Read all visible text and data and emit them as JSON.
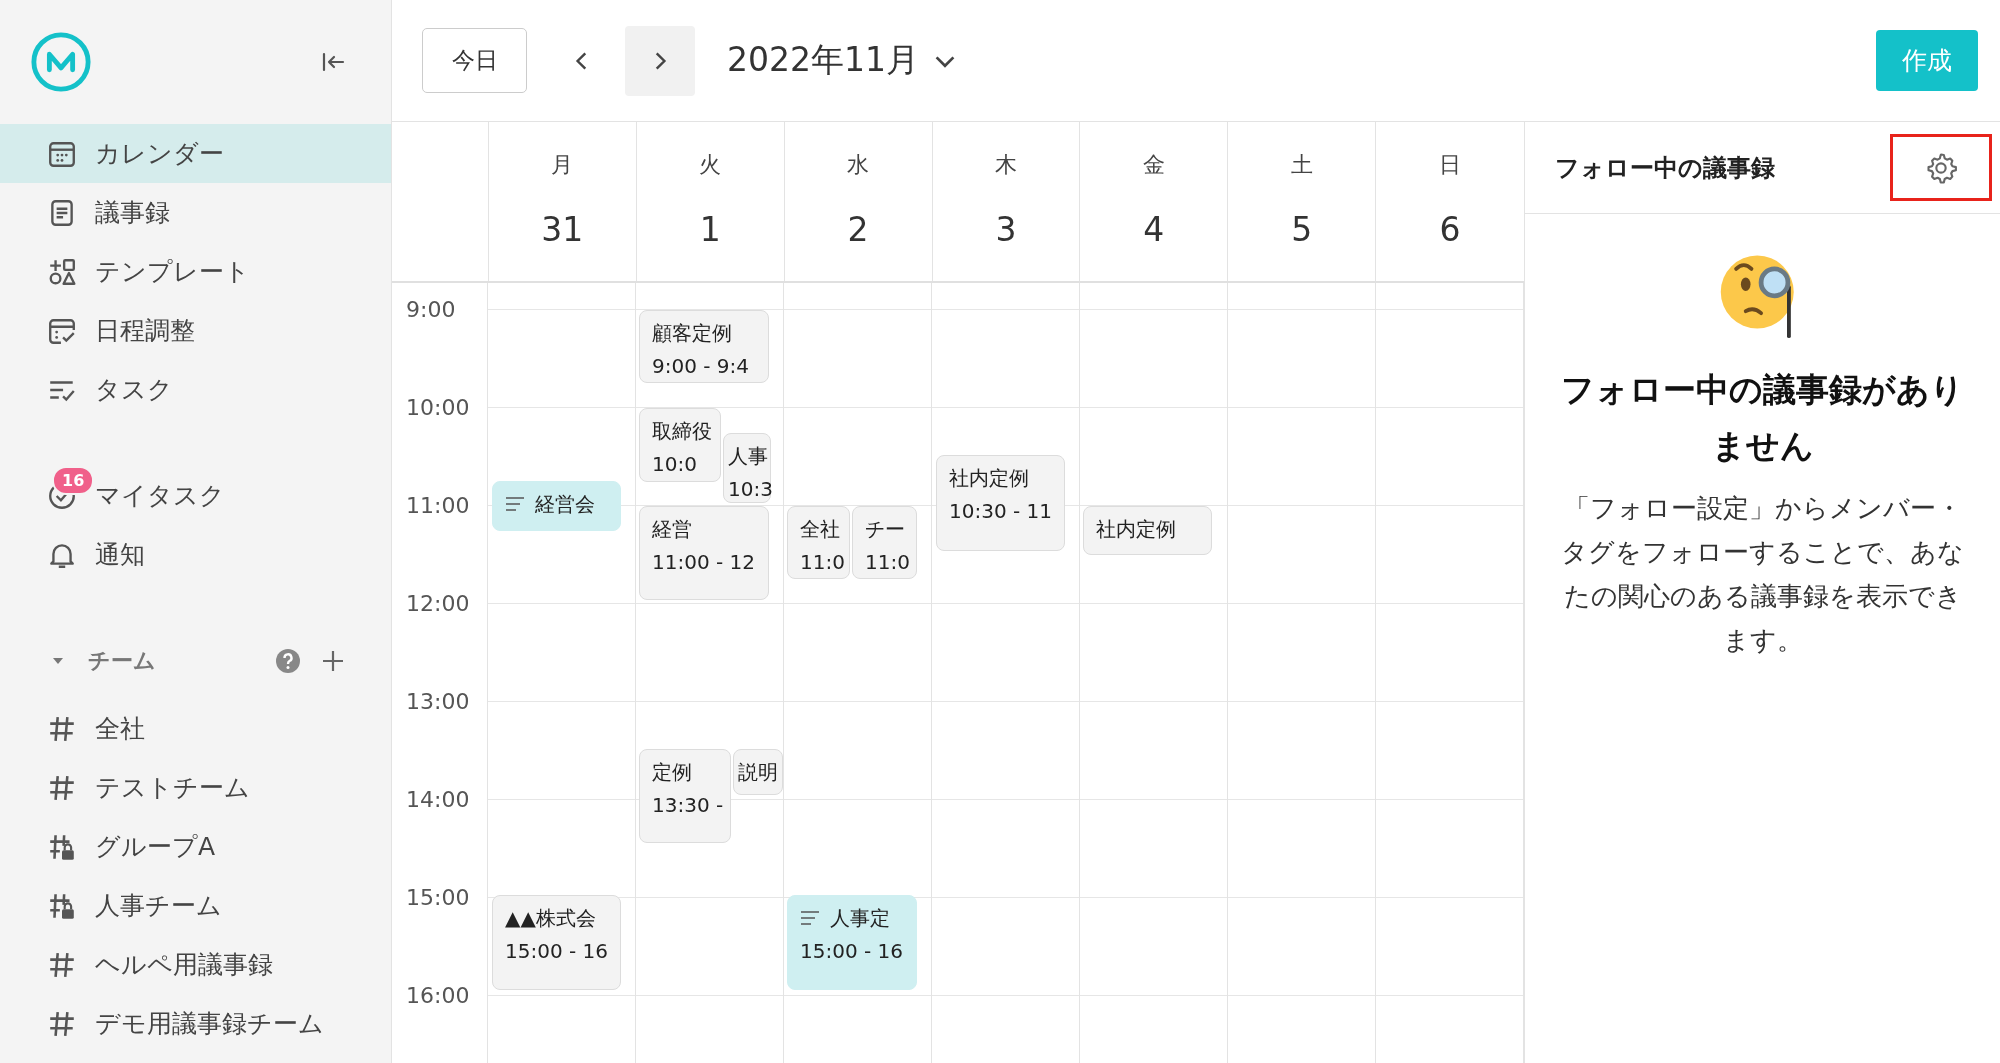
{
  "sidebar": {
    "nav_items": [
      {
        "label": "カレンダー",
        "kind": "calendar",
        "selected": true
      },
      {
        "label": "議事録",
        "kind": "notes",
        "selected": false
      },
      {
        "label": "テンプレート",
        "kind": "template",
        "selected": false
      },
      {
        "label": "日程調整",
        "kind": "schedule",
        "selected": false
      },
      {
        "label": "タスク",
        "kind": "tasks",
        "selected": false
      }
    ],
    "personal_items": [
      {
        "label": "マイタスク",
        "kind": "mytasks",
        "badge": "16",
        "selected": false
      },
      {
        "label": "通知",
        "kind": "bell",
        "selected": false
      }
    ],
    "team_section": {
      "label": "チーム",
      "expanded": true,
      "teams": [
        {
          "label": "全社",
          "locked": false,
          "selected": false
        },
        {
          "label": "テストチーム",
          "locked": false,
          "selected": false
        },
        {
          "label": "グループA",
          "locked": true,
          "selected": false
        },
        {
          "label": "人事チーム",
          "locked": true,
          "selected": false
        },
        {
          "label": "ヘルペ用議事録",
          "locked": false,
          "selected": false
        },
        {
          "label": "デモ用議事録チーム",
          "locked": false,
          "selected": false
        }
      ]
    }
  },
  "toolbar": {
    "today_button": "今日",
    "month_title": "2022年11月",
    "create_button": "作成"
  },
  "calendar": {
    "hours": [
      "9:00",
      "10:00",
      "11:00",
      "12:00",
      "13:00",
      "14:00",
      "15:00",
      "16:00"
    ],
    "days": [
      {
        "weekday": "月",
        "date": "31",
        "events": [
          {
            "title": "経営会",
            "kind": "note"
          },
          {
            "title": "▲▲株式会",
            "time": "15:00 - 16",
            "kind": "plain"
          }
        ]
      },
      {
        "weekday": "火",
        "date": "1",
        "events": [
          {
            "title": "顧客定例",
            "time": "9:00 - 9:4",
            "kind": "plain"
          },
          {
            "title": "取締役",
            "time": "10:0",
            "kind": "plain"
          },
          {
            "title": "人事",
            "time": "10:3",
            "kind": "plain"
          },
          {
            "title": "経営",
            "time": "11:00 - 12",
            "kind": "plain"
          },
          {
            "title": "定例",
            "time": "13:30 -",
            "kind": "plain"
          },
          {
            "title": "説明",
            "kind": "plain"
          }
        ]
      },
      {
        "weekday": "水",
        "date": "2",
        "events": [
          {
            "title": "全社",
            "time": "11:0",
            "kind": "plain"
          },
          {
            "title": "チー",
            "time": "11:0",
            "kind": "plain"
          },
          {
            "title": "人事定",
            "time": "15:00 - 16",
            "kind": "note"
          }
        ]
      },
      {
        "weekday": "木",
        "date": "3",
        "events": [
          {
            "title": "社内定例",
            "time": "10:30 - 11",
            "kind": "plain"
          }
        ]
      },
      {
        "weekday": "金",
        "date": "4",
        "events": [
          {
            "title": "社内定例",
            "kind": "plain"
          }
        ]
      },
      {
        "weekday": "土",
        "date": "5"
      },
      {
        "weekday": "日",
        "date": "6"
      }
    ]
  },
  "follow_panel": {
    "title": "フォロー中の議事録",
    "settings_highlighted": true,
    "empty_heading": "フォロー中の議事録がありません",
    "empty_text": "「フォロー設定」からメンバー・タグをフォローすることで、あなたの関心のある議事録を表示できます。"
  }
}
